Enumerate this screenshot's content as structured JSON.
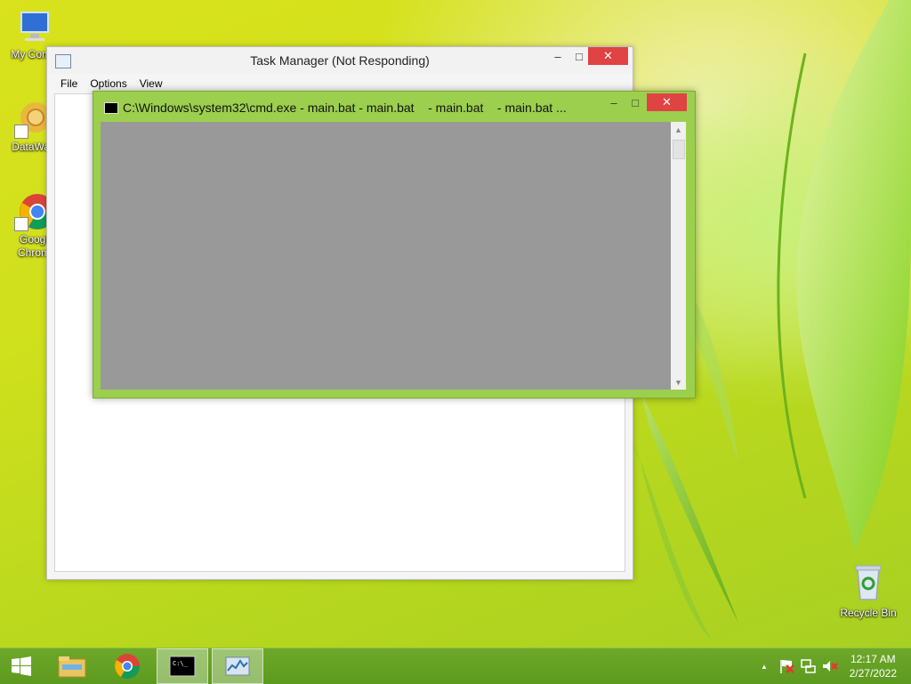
{
  "desktop": {
    "icons": [
      {
        "label": "My Comp",
        "icon": "computer-icon"
      },
      {
        "label": "DataWag",
        "icon": "datawag-icon"
      },
      {
        "label": "Googl",
        "label2": "Chrom",
        "icon": "chrome-icon"
      }
    ],
    "recycle_bin": {
      "label": "Recycle Bin",
      "icon": "recycle-bin-icon"
    }
  },
  "task_manager": {
    "title": "Task Manager (Not Responding)",
    "menu": [
      "File",
      "Options",
      "View"
    ],
    "minimize": "–",
    "maximize": "□",
    "close": "✕"
  },
  "cmd": {
    "title": "C:\\Windows\\system32\\cmd.exe - main.bat - main.bat    - main.bat    - main.bat ...",
    "minimize": "–",
    "maximize": "□",
    "close": "✕",
    "scroll_up": "▲",
    "scroll_down": "▼"
  },
  "taskbar": {
    "items": [
      "start-button",
      "file-explorer",
      "chrome",
      "cmd",
      "task-manager"
    ],
    "active": [
      "cmd",
      "task-manager"
    ],
    "tray_expand": "▲",
    "clock_time": "12:17 AM",
    "clock_date": "2/27/2022"
  },
  "colors": {
    "taskbar": "#6ea82a",
    "cmd_frame": "#9ccf4e",
    "cmd_body": "#999999",
    "close_button": "#e04343"
  }
}
